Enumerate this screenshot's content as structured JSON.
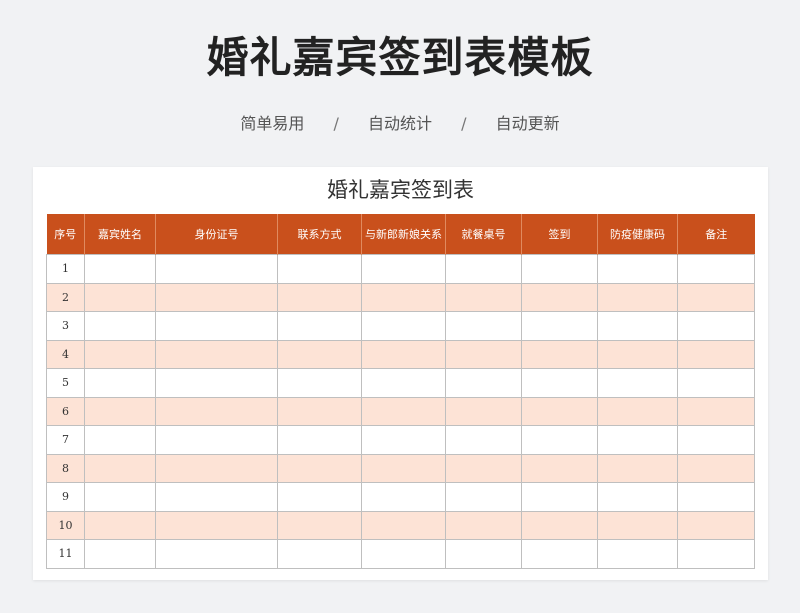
{
  "header": {
    "title": "婚礼嘉宾签到表模板",
    "features": [
      "简单易用",
      "自动统计",
      "自动更新"
    ],
    "separator": "/"
  },
  "sheet": {
    "title": "婚礼嘉宾签到表",
    "columns": [
      "序号",
      "嘉宾姓名",
      "身份证号",
      "联系方式",
      "与新郎新娘关系",
      "就餐桌号",
      "签到",
      "防疫健康码",
      "备注"
    ],
    "rows": [
      "1",
      "2",
      "3",
      "4",
      "5",
      "6",
      "7",
      "8",
      "9",
      "10",
      "11"
    ]
  },
  "colors": {
    "header_bg": "#c9501c",
    "stripe": "#fde3d6",
    "page_bg": "#f1f2f4"
  }
}
